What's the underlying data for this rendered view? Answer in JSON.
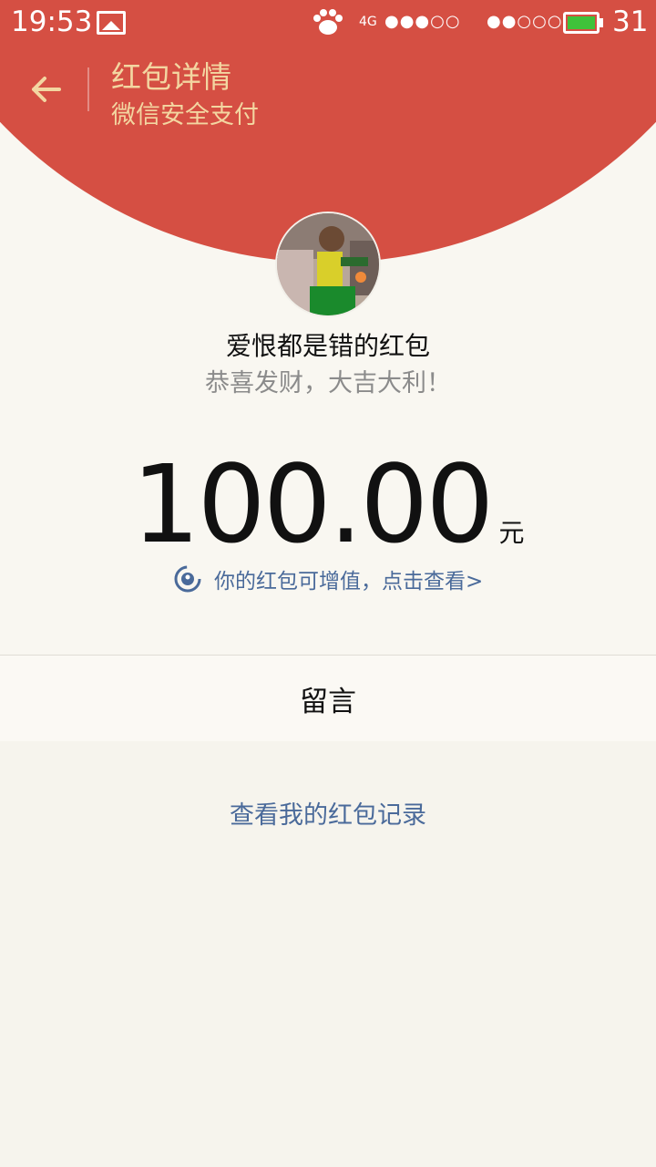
{
  "status_bar": {
    "time": "19:53",
    "network": "4G",
    "signal_sim1": "●●●○○",
    "signal_sim2": "●●○○○",
    "battery": "31",
    "battery_color": "#3fc23a"
  },
  "header": {
    "title": "红包详情",
    "subtitle": "微信安全支付",
    "back_icon": "arrow-left-icon",
    "background": "#d54f43",
    "text_color": "#f3d6a1"
  },
  "red_packet": {
    "sender": "爱恨都是错的红包",
    "blessing": "恭喜发财，大吉大利！",
    "amount": "100.00",
    "unit": "元",
    "increase_link": "你的红包可增值，点击查看>"
  },
  "message_label": "留言",
  "records_link": "查看我的红包记录",
  "link_color": "#4a6a9a"
}
